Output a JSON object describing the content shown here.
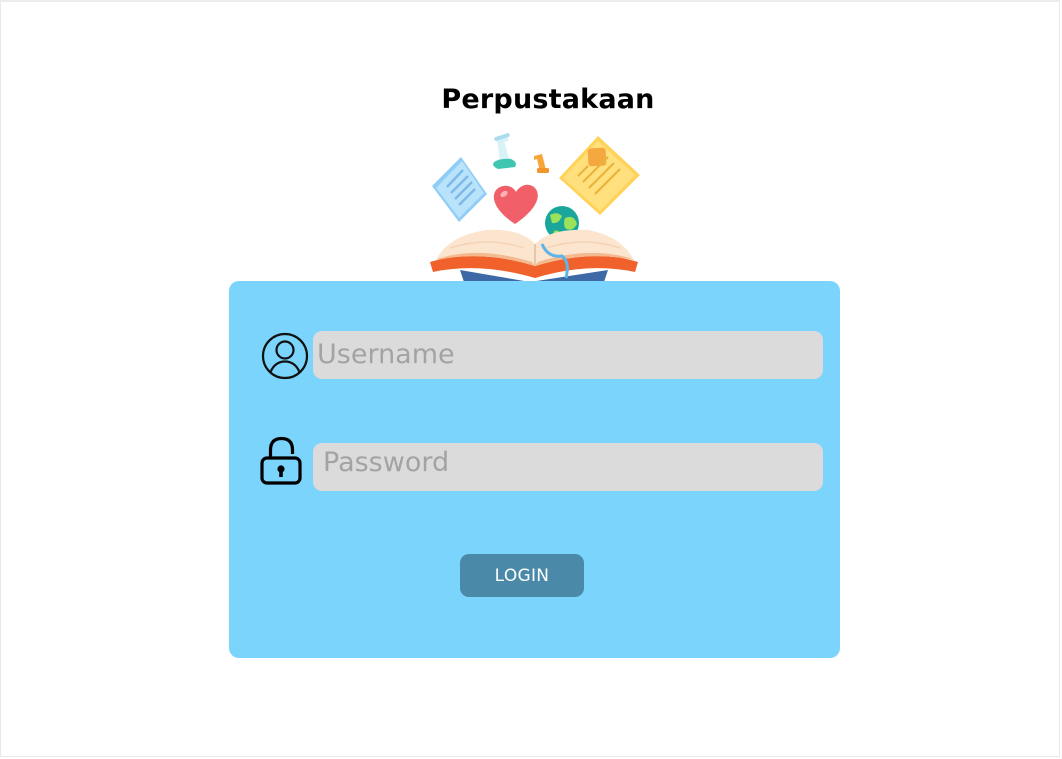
{
  "page": {
    "title": "Perpustakaan"
  },
  "illustration": {
    "icon": "open-book-illustration"
  },
  "form": {
    "username": {
      "icon": "user-circle-icon",
      "placeholder": "Username",
      "value": ""
    },
    "password": {
      "icon": "lock-icon",
      "placeholder": "Password",
      "value": ""
    },
    "login_label": "LOGIN"
  },
  "colors": {
    "card_background": "#7ad4fc",
    "field_background": "#dbdbdb",
    "button_background": "#4a89a8",
    "button_text": "#ffffff",
    "title_text": "#000000"
  }
}
